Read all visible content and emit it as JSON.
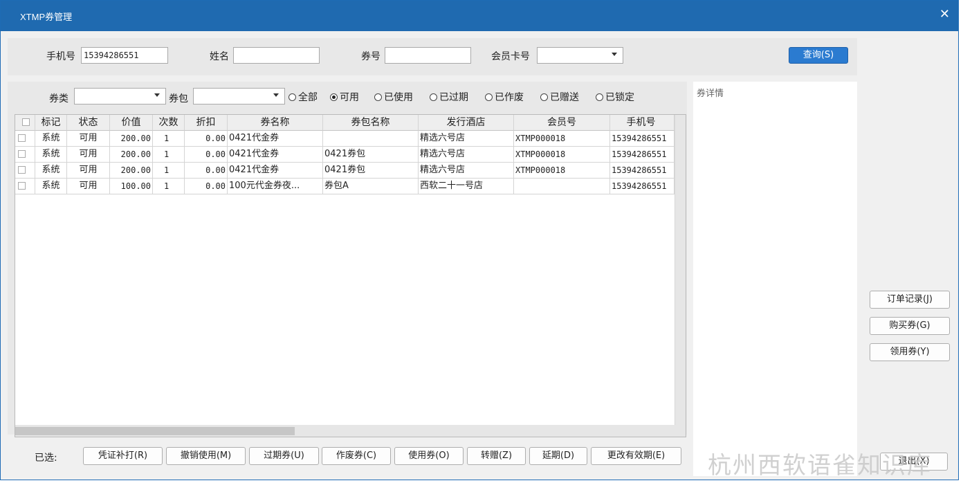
{
  "window": {
    "title": "XTMP券管理",
    "close": "✕"
  },
  "search": {
    "phone_label": "手机号",
    "phone_value": "15394286551",
    "name_label": "姓名",
    "name_value": "",
    "coupon_no_label": "券号",
    "coupon_no_value": "",
    "member_card_label": "会员卡号",
    "member_card_value": "",
    "query_button": "查询(S)"
  },
  "filter": {
    "coupon_type_label": "券类",
    "coupon_type_value": "",
    "coupon_pack_label": "券包",
    "coupon_pack_value": "",
    "radios": [
      {
        "label": "全部",
        "checked": false
      },
      {
        "label": "可用",
        "checked": true
      },
      {
        "label": "已使用",
        "checked": false
      },
      {
        "label": "已过期",
        "checked": false
      },
      {
        "label": "已作废",
        "checked": false
      },
      {
        "label": "已赠送",
        "checked": false
      },
      {
        "label": "已锁定",
        "checked": false
      }
    ]
  },
  "table": {
    "headers": [
      "",
      "标记",
      "状态",
      "价值",
      "次数",
      "折扣",
      "券名称",
      "券包名称",
      "发行酒店",
      "会员号",
      "手机号"
    ],
    "rows": [
      [
        "",
        "系统",
        "可用",
        "200.00",
        "1",
        "0.00",
        "0421代金券",
        "",
        "精选六号店",
        "XTMP000018",
        "15394286551"
      ],
      [
        "",
        "系统",
        "可用",
        "200.00",
        "1",
        "0.00",
        "0421代金券",
        "0421券包",
        "精选六号店",
        "XTMP000018",
        "15394286551"
      ],
      [
        "",
        "系统",
        "可用",
        "200.00",
        "1",
        "0.00",
        "0421代金券",
        "0421券包",
        "精选六号店",
        "XTMP000018",
        "15394286551"
      ],
      [
        "",
        "系统",
        "可用",
        "100.00",
        "1",
        "0.00",
        "100元代金券夜...",
        "券包A",
        "西软二十一号店",
        "",
        "15394286551"
      ]
    ]
  },
  "detail": {
    "label": "券详情"
  },
  "side_buttons": {
    "order_record": "订单记录(J)",
    "buy_coupon": "购买券(G)",
    "claim_coupon": "领用券(Y)"
  },
  "bottom": {
    "selected_label": "已选:",
    "buttons": {
      "reprint": "凭证补打(R)",
      "revoke": "撤销使用(M)",
      "expire": "过期券(U)",
      "void": "作废券(C)",
      "use": "使用券(O)",
      "transfer": "转赠(Z)",
      "extend": "延期(D)",
      "change_validity": "更改有效期(E)",
      "exit": "退出(X)"
    }
  },
  "watermark": "杭州西软语雀知识库"
}
